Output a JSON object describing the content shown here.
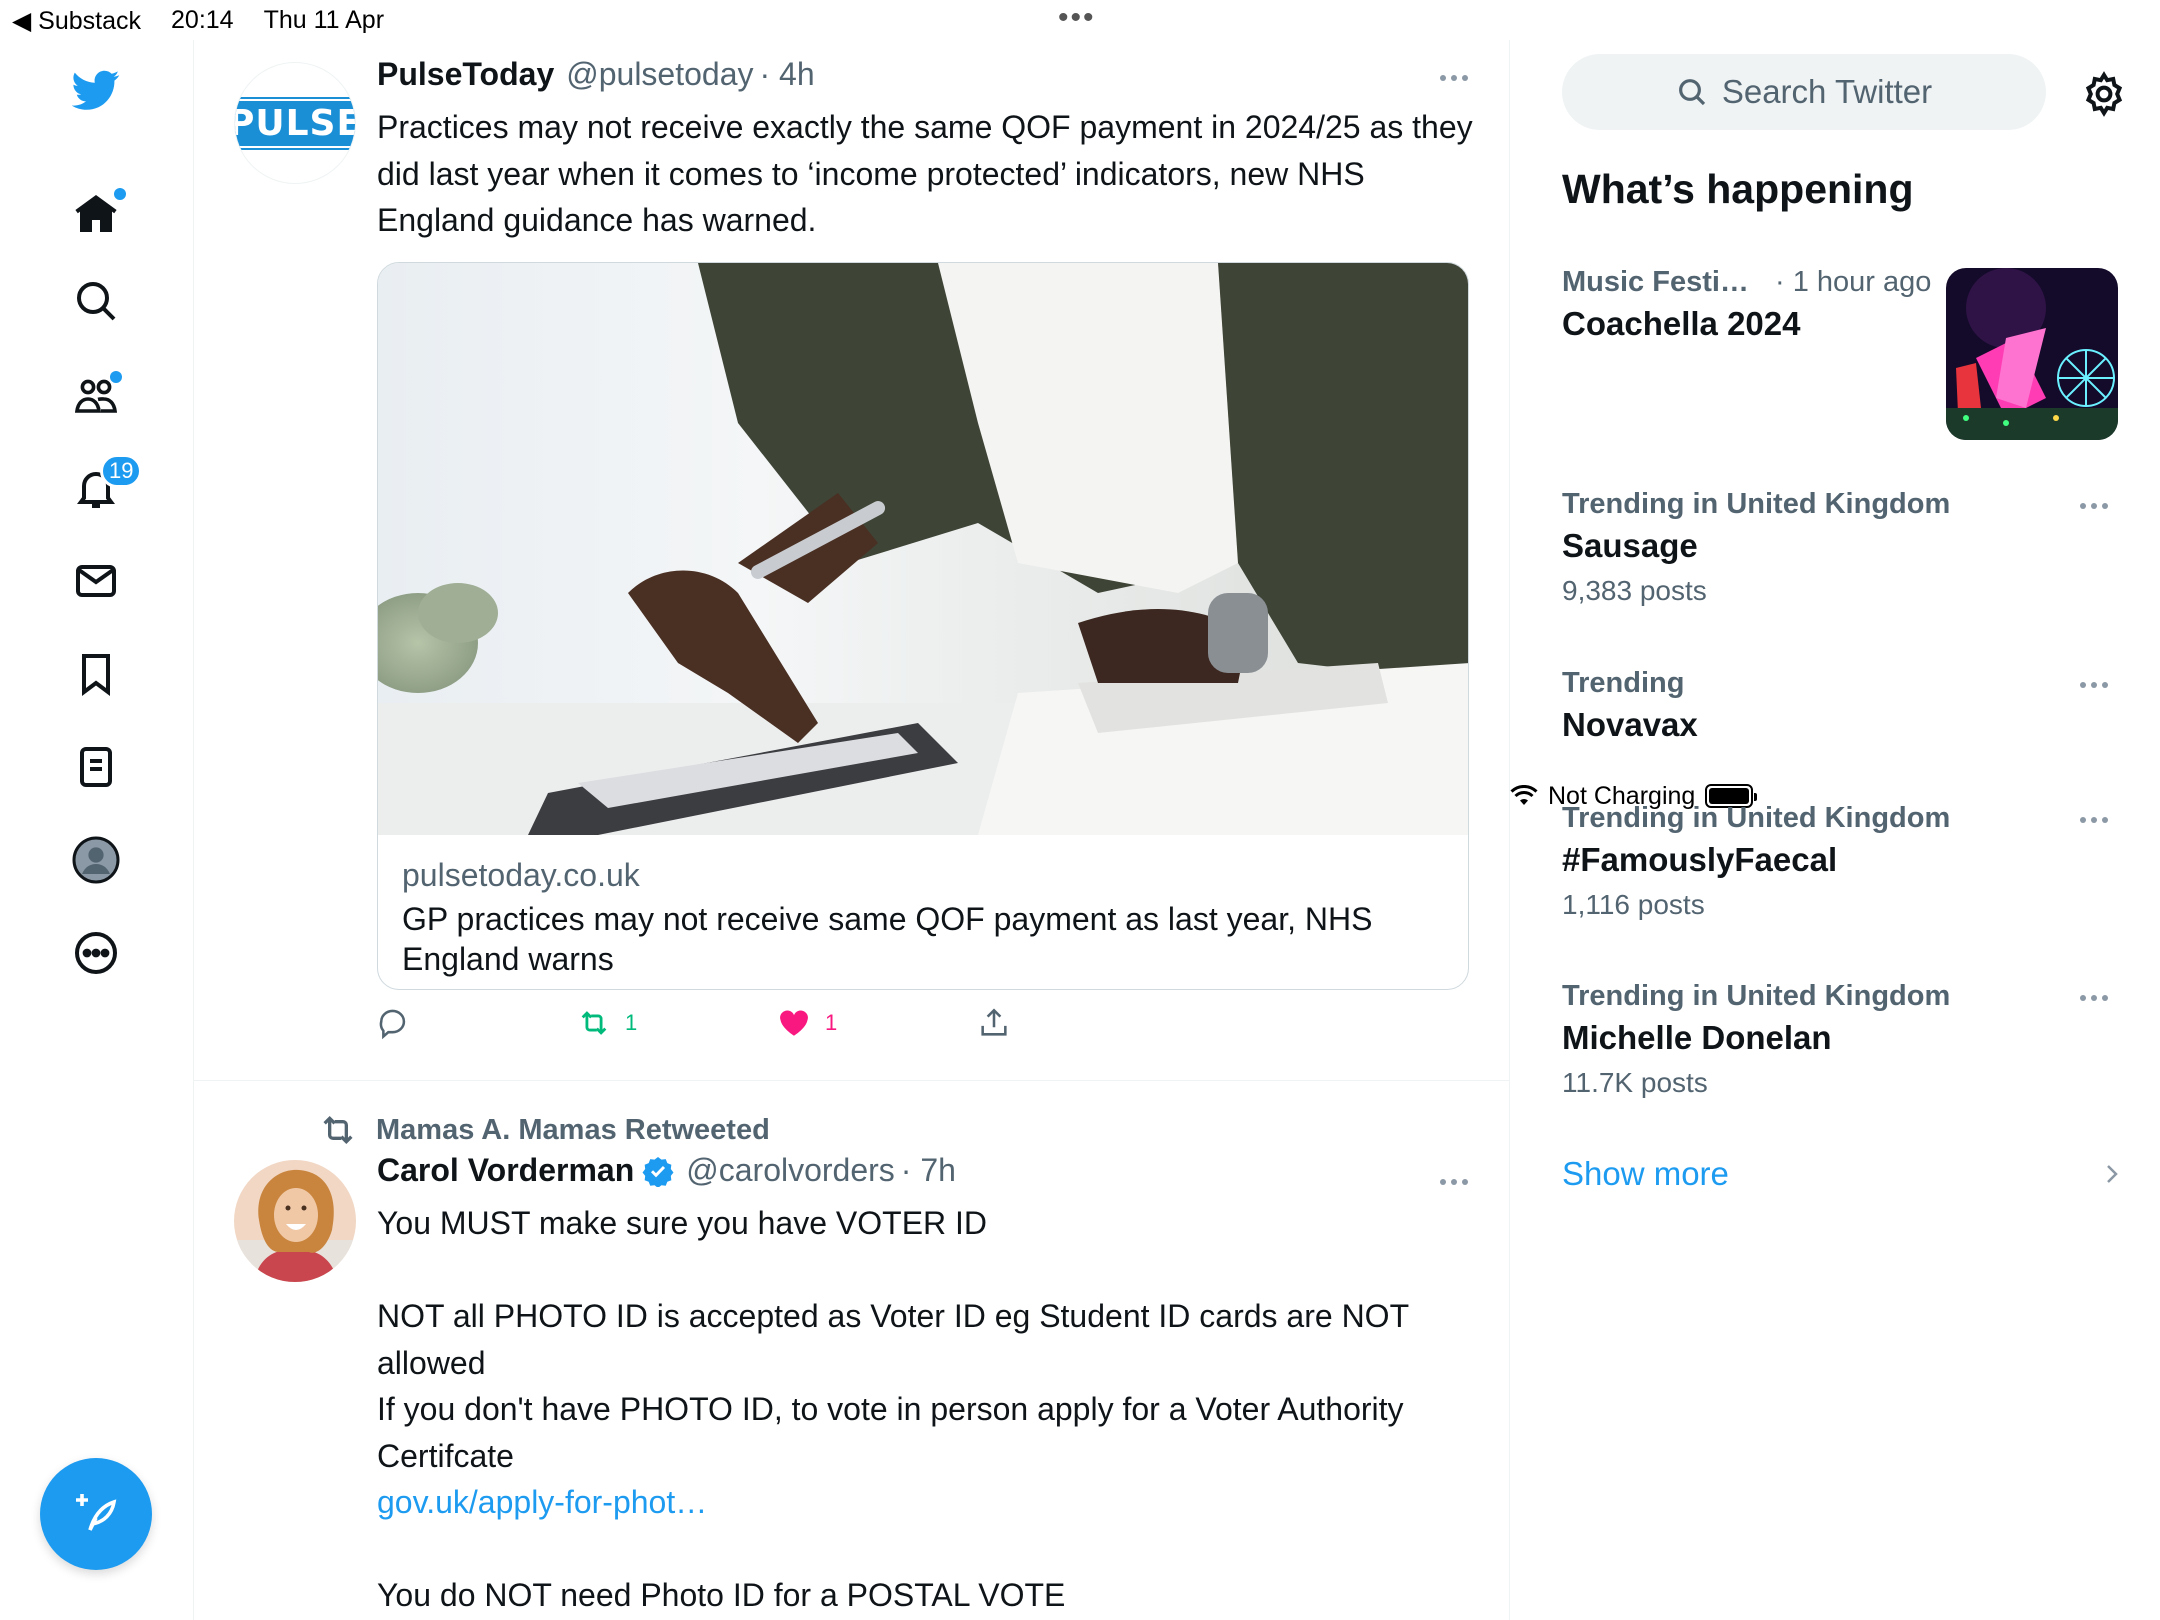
{
  "status_bar": {
    "back_app": "◀ Substack",
    "time": "20:14",
    "date": "Thu 11 Apr",
    "charging": "Not Charging"
  },
  "nav": {
    "items": [
      "twitter-logo",
      "home",
      "explore",
      "communities",
      "notifications",
      "messages",
      "bookmarks",
      "lists",
      "profile",
      "more"
    ],
    "notifications_badge": "19"
  },
  "tweets": [
    {
      "name": "PulseToday",
      "handle": "@pulsetoday",
      "time": "· 4h",
      "avatar_text": "PULSE",
      "text": "Practices may not receive exactly the same QOF payment in 2024/25 as they did last year when it comes to ‘income protected’ indicators, new NHS England guidance has warned.",
      "card": {
        "domain": "pulsetoday.co.uk",
        "title": "GP practices may not receive same QOF payment as last year, NHS England warns"
      },
      "retweets": "1",
      "likes": "1"
    },
    {
      "retweeted_by": "Mamas A. Mamas Retweeted",
      "name": "Carol Vorderman",
      "handle": "@carolvorders",
      "time": "· 7h",
      "lines": [
        "You MUST make sure you have VOTER ID",
        "NOT all PHOTO ID is accepted as Voter ID eg Student ID cards are NOT allowed",
        "If you don't have PHOTO ID, to vote in person apply for a Voter Authority Certifcate",
        "gov.uk/apply-for-phot…",
        "You do NOT need Photo ID for a POSTAL VOTE"
      ]
    }
  ],
  "sidebar": {
    "search_placeholder": "Search Twitter",
    "title": "What’s happening",
    "trends": [
      {
        "context": "Music Festi…",
        "time": "· 1 hour ago",
        "name": "Coachella 2024",
        "count": ""
      },
      {
        "context": "Trending in United Kingdom",
        "name": "Sausage",
        "count": "9,383 posts"
      },
      {
        "context": "Trending",
        "name": "Novavax",
        "count": ""
      },
      {
        "context": "Trending in United Kingdom",
        "name": "#FamouslyFaecal",
        "count": "1,116 posts"
      },
      {
        "context": "Trending in United Kingdom",
        "name": "Michelle Donelan",
        "count": "11.7K posts"
      }
    ],
    "show_more": "Show more"
  },
  "colors": {
    "accent": "#1d9bf0",
    "retweet_green": "#00ba7c",
    "like_pink": "#f91880",
    "secondary_text": "#536471"
  }
}
